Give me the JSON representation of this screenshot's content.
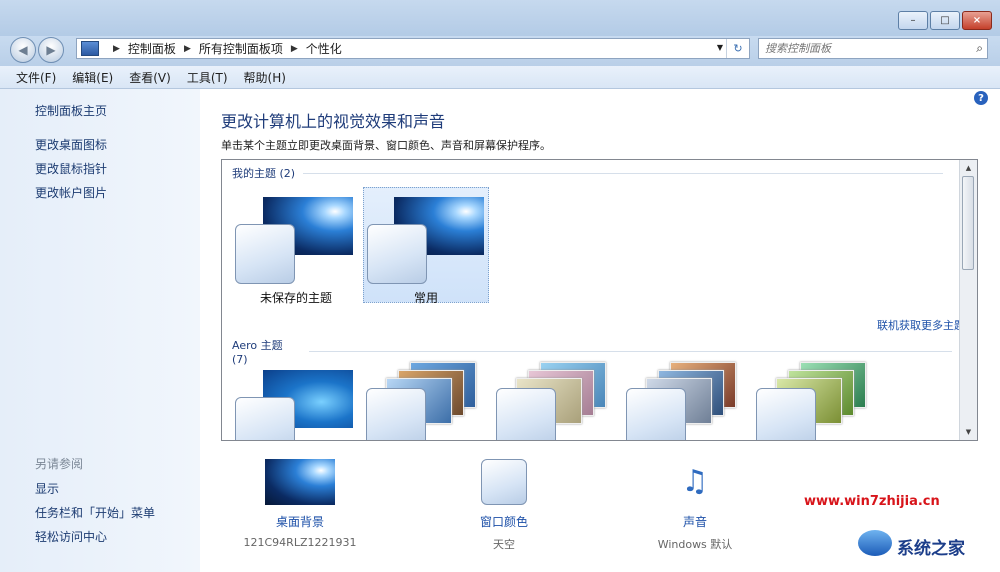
{
  "window": {
    "minimize": "–",
    "maximize": "□",
    "close": "×"
  },
  "nav": {
    "back": "◀",
    "forward": "▶"
  },
  "address": {
    "crumbs": [
      "控制面板",
      "所有控制面板项",
      "个性化"
    ],
    "refresh": "↻"
  },
  "search": {
    "placeholder": "搜索控制面板"
  },
  "menu": [
    "文件(F)",
    "编辑(E)",
    "查看(V)",
    "工具(T)",
    "帮助(H)"
  ],
  "sidebar": {
    "home": "控制面板主页",
    "links": [
      "更改桌面图标",
      "更改鼠标指针",
      "更改帐户图片"
    ],
    "see_also": "另请参阅",
    "see_also_links": [
      "显示",
      "任务栏和「开始」菜单",
      "轻松访问中心"
    ]
  },
  "main": {
    "title": "更改计算机上的视觉效果和声音",
    "description": "单击某个主题立即更改桌面背景、窗口颜色、声音和屏幕保护程序。",
    "my_themes_label": "我的主题 (2)",
    "my_themes": [
      "未保存的主题",
      "常用"
    ],
    "get_more": "联机获取更多主题",
    "aero_label": "Aero 主题 (7)"
  },
  "bottom": [
    {
      "label": "桌面背景",
      "value": "121C94RLZ1221931"
    },
    {
      "label": "窗口颜色",
      "value": "天空"
    },
    {
      "label": "声音",
      "value": "Windows 默认"
    }
  ],
  "watermark": {
    "url": "www.win7zhijia.cn",
    "brand": "系统之家"
  },
  "help": "?"
}
